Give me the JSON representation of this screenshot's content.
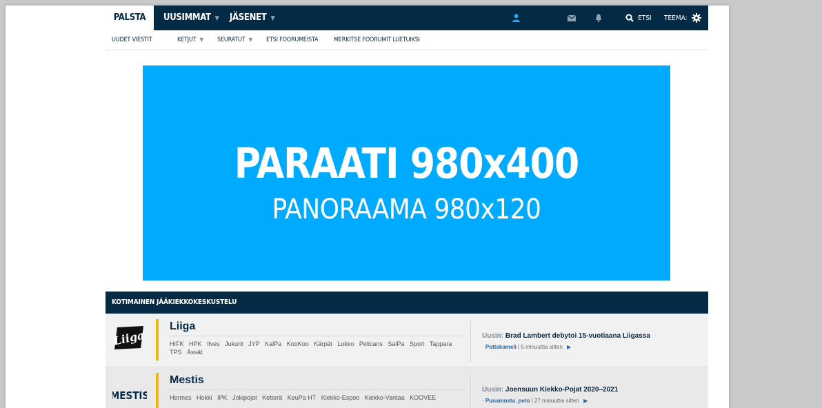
{
  "topnav": {
    "palsta": "PALSTA",
    "uusimmat": "UUSIMMAT",
    "jasenet": "JÄSENET",
    "search_label": "ETSI",
    "theme_label": "TEEMA:",
    "icons": [
      "user-icon",
      "envelope-icon",
      "bell-icon",
      "search-icon",
      "gear-icon"
    ]
  },
  "subnav": {
    "uudet_viestit": "UUDET VIESTIT",
    "ketjut": "KETJUT",
    "seuratut": "SEURATUT",
    "etsi_foorumeista": "ETSI FOORUMEISTA",
    "merkitse": "MERKITSE FOORUMIT LUETUIKSI"
  },
  "ad": {
    "line1": "PARAATI 980x400",
    "line2": "PANORAAMA 980x120",
    "color": "#00aaff"
  },
  "category": {
    "title": "KOTIMAINEN JÄÄKIEKKOKESKUSTELU"
  },
  "forums": [
    {
      "logo": "Liiga",
      "title": "Liiga",
      "subforums": [
        "HIFK",
        "HPK",
        "Ilves",
        "Jukurit",
        "JYP",
        "KalPa",
        "KooKoo",
        "Kärpät",
        "Lukko",
        "Pelicans",
        "SaiPa",
        "Sport",
        "Tappara",
        "TPS",
        "Ässät"
      ],
      "latest_prefix": "Uusin:",
      "latest_title": "Brad Lambert debytoi 15-vuotiaana Liigassa",
      "latest_user": "Pottakameli",
      "latest_time": "5 minuuttia sitten"
    },
    {
      "logo": "MESTIS",
      "title": "Mestis",
      "subforums": [
        "Hermes",
        "Hokki",
        "IPK",
        "Jokipojat",
        "Ketterä",
        "KeuPa HT",
        "Kiekko-Espoo",
        "Kiekko-Vantaa",
        "KOOVEE"
      ],
      "latest_prefix": "Uusin:",
      "latest_title": "Joensuun Kiekko-Pojat 2020–2021",
      "latest_user": "Punamusta_peto",
      "latest_time": "27 minuuttia sitten"
    }
  ],
  "colors": {
    "navy": "#052a45",
    "accent_bar": "#f2b705",
    "link": "#2465a8"
  }
}
